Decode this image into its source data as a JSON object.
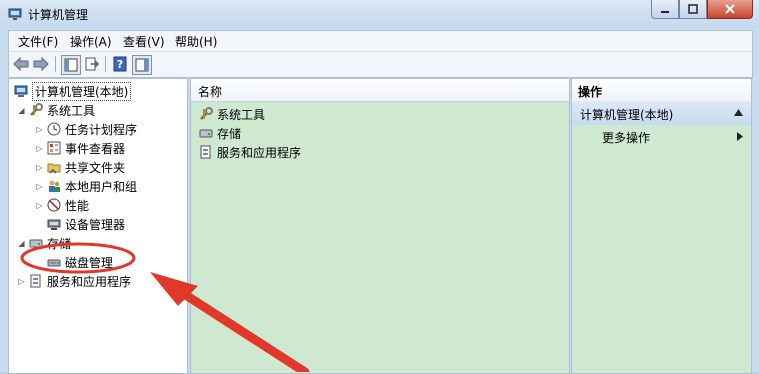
{
  "window": {
    "title": "计算机管理"
  },
  "menu": [
    "文件(F)",
    "操作(A)",
    "查看(V)",
    "帮助(H)"
  ],
  "toolbar_icons": [
    "back-arrow-icon",
    "forward-arrow-icon",
    "show-hide-tree-icon",
    "export-list-icon",
    "help-icon",
    "show-hide-action-pane-icon"
  ],
  "tree": {
    "root": "计算机管理(本地)",
    "system_tools": "系统工具",
    "system_children": [
      "任务计划程序",
      "事件查看器",
      "共享文件夹",
      "本地用户和组",
      "性能",
      "设备管理器"
    ],
    "storage": "存储",
    "disk_management": "磁盘管理",
    "services": "服务和应用程序"
  },
  "center": {
    "column_header": "名称",
    "items": [
      "系统工具",
      "存储",
      "服务和应用程序"
    ]
  },
  "actions": {
    "header": "操作",
    "section_title": "计算机管理(本地)",
    "more_actions": "更多操作"
  },
  "annotation": {
    "color": "#e2382a",
    "highlight_target": "磁盘管理"
  }
}
